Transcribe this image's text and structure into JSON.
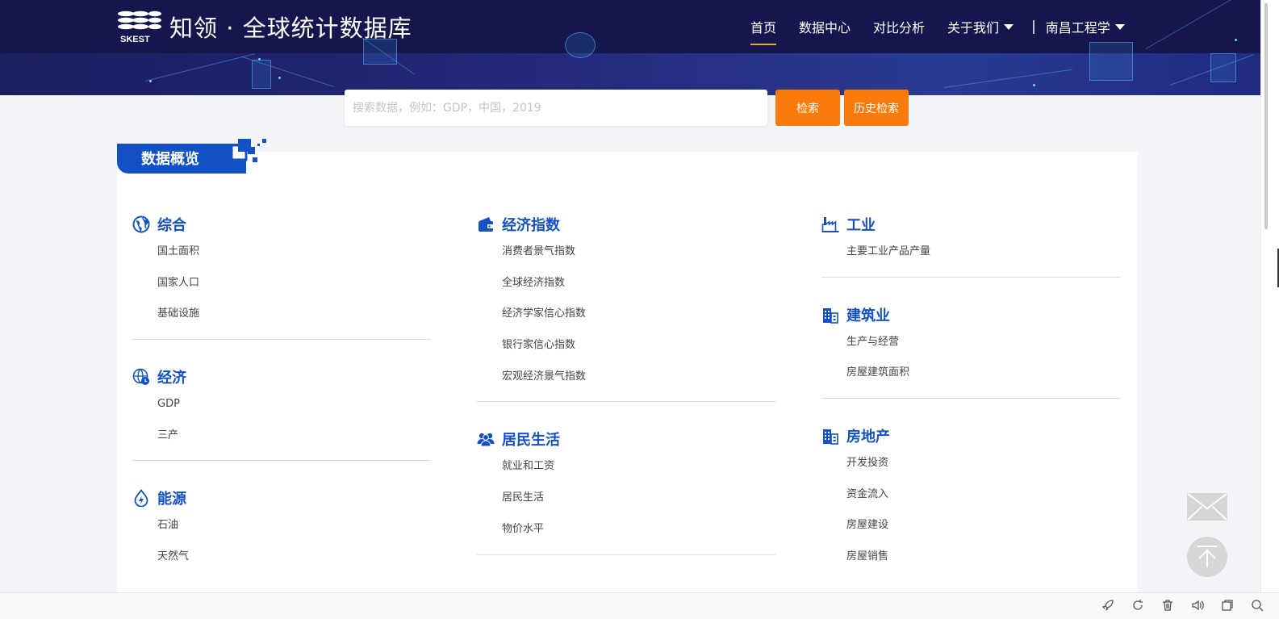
{
  "header": {
    "logo_text": "SKEST",
    "title": "知领 · 全球统计数据库",
    "nav": [
      {
        "label": "首页",
        "active": true
      },
      {
        "label": "数据中心"
      },
      {
        "label": "对比分析"
      },
      {
        "label": "关于我们",
        "dropdown": true
      }
    ],
    "separator": "|",
    "institution": "南昌工程学"
  },
  "search": {
    "placeholder": "搜索数据，例如：GDP，中国，2019",
    "search_label": "检索",
    "history_label": "历史检索"
  },
  "overview": {
    "tab_label": "数据概览",
    "columns": [
      [
        {
          "title": "综合",
          "icon": "globe-icon",
          "items": [
            "国土面积",
            "国家人口",
            "基础设施"
          ]
        },
        {
          "title": "经济",
          "icon": "globe-clock-icon",
          "items": [
            "GDP",
            "三产"
          ]
        },
        {
          "title": "能源",
          "icon": "energy-icon",
          "items": [
            "石油",
            "天然气"
          ]
        }
      ],
      [
        {
          "title": "经济指数",
          "icon": "wallet-icon",
          "items": [
            "消费者景气指数",
            "全球经济指数",
            "经济学家信心指数",
            "银行家信心指数",
            "宏观经济景气指数"
          ]
        },
        {
          "title": "居民生活",
          "icon": "people-icon",
          "items": [
            "就业和工资",
            "居民生活",
            "物价水平"
          ]
        }
      ],
      [
        {
          "title": "工业",
          "icon": "factory-icon",
          "items": [
            "主要工业产品产量"
          ]
        },
        {
          "title": "建筑业",
          "icon": "building-icon",
          "items": [
            "生产与经营",
            "房屋建筑面积"
          ]
        },
        {
          "title": "房地产",
          "icon": "real-estate-icon",
          "items": [
            "开发投资",
            "资金流入",
            "房屋建设",
            "房屋销售"
          ]
        }
      ]
    ]
  },
  "colors": {
    "brand_blue": "#1451c4",
    "header_dark": "#14164d",
    "accent_orange": "#fa7a0b",
    "nav_active_underline": "#f7a21b"
  },
  "toolbar_icons": [
    "rocket-icon",
    "refresh-icon",
    "trash-icon",
    "speaker-icon",
    "window-icon",
    "search-icon"
  ]
}
